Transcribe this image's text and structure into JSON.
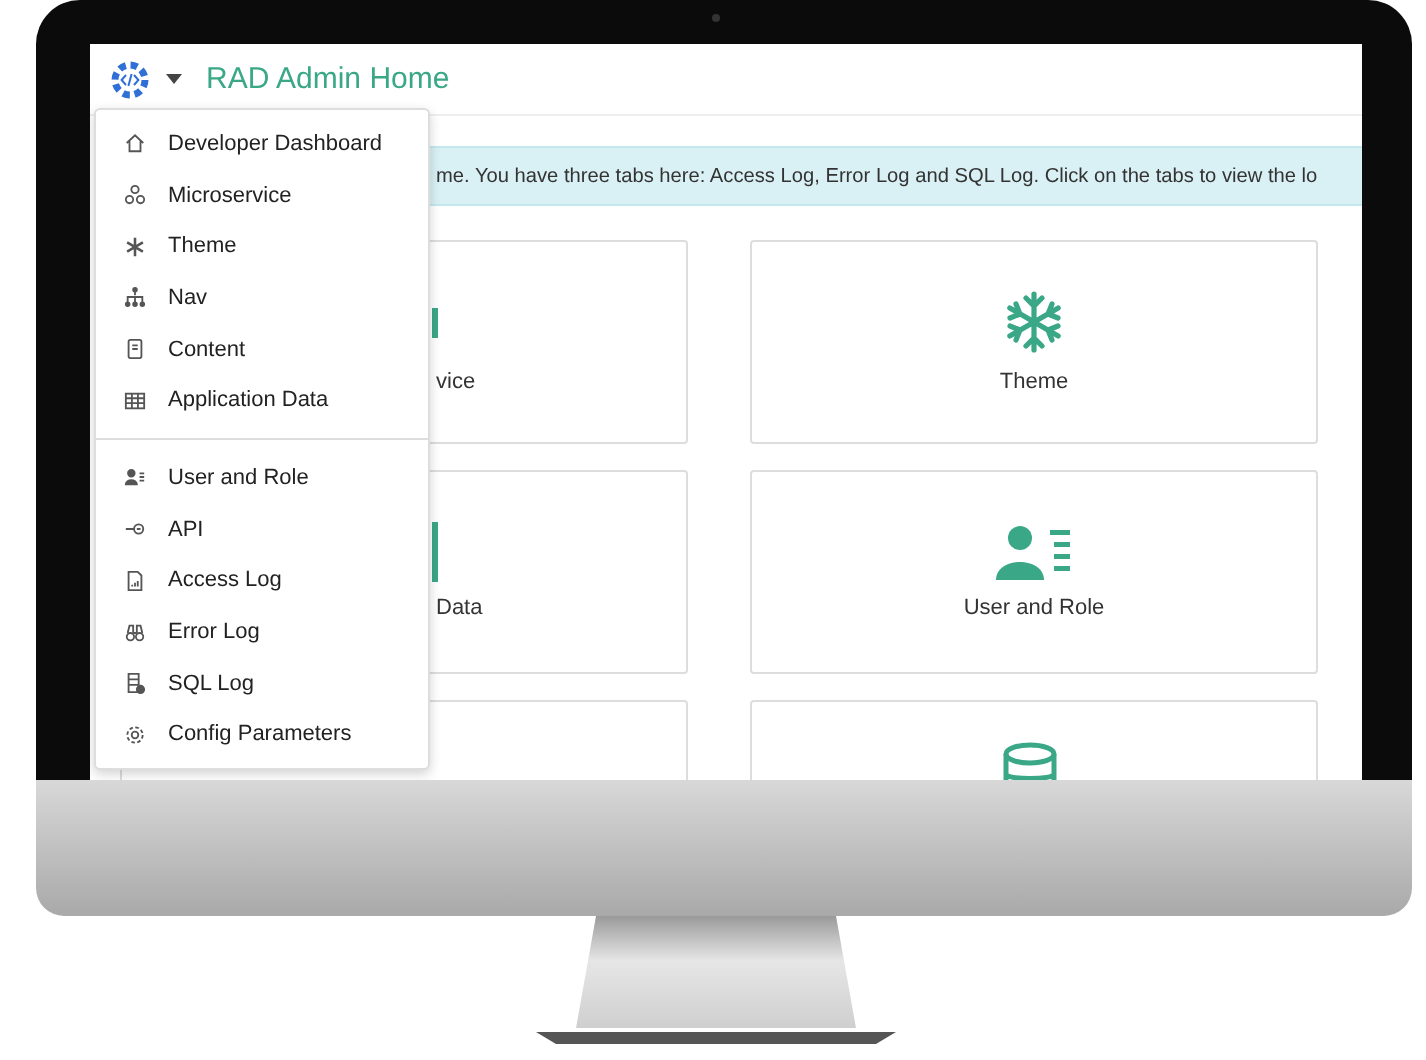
{
  "header": {
    "title": "RAD Admin Home"
  },
  "menu": {
    "groups": [
      {
        "items": [
          {
            "label": "Developer Dashboard"
          },
          {
            "label": "Microservice"
          },
          {
            "label": "Theme"
          },
          {
            "label": "Nav"
          },
          {
            "label": "Content"
          },
          {
            "label": "Application Data"
          }
        ]
      },
      {
        "items": [
          {
            "label": "User and Role"
          },
          {
            "label": "API"
          },
          {
            "label": "Access Log"
          },
          {
            "label": "Error Log"
          },
          {
            "label": "SQL Log"
          },
          {
            "label": "Config Parameters"
          }
        ]
      }
    ]
  },
  "alert": {
    "text": "me. You have three tabs here: Access Log, Error Log and SQL Log. Click on the tabs to view the lo"
  },
  "cards": [
    {
      "label": "vice"
    },
    {
      "label": "Theme"
    },
    {
      "label": "Data"
    },
    {
      "label": "User and Role"
    }
  ]
}
